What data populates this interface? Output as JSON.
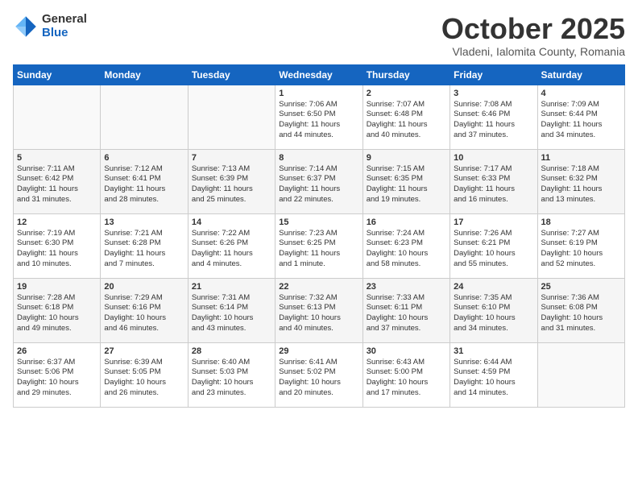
{
  "logo": {
    "general": "General",
    "blue": "Blue"
  },
  "title": "October 2025",
  "subtitle": "Vladeni, Ialomita County, Romania",
  "days_header": [
    "Sunday",
    "Monday",
    "Tuesday",
    "Wednesday",
    "Thursday",
    "Friday",
    "Saturday"
  ],
  "weeks": [
    [
      {
        "day": "",
        "content": ""
      },
      {
        "day": "",
        "content": ""
      },
      {
        "day": "",
        "content": ""
      },
      {
        "day": "1",
        "content": "Sunrise: 7:06 AM\nSunset: 6:50 PM\nDaylight: 11 hours\nand 44 minutes."
      },
      {
        "day": "2",
        "content": "Sunrise: 7:07 AM\nSunset: 6:48 PM\nDaylight: 11 hours\nand 40 minutes."
      },
      {
        "day": "3",
        "content": "Sunrise: 7:08 AM\nSunset: 6:46 PM\nDaylight: 11 hours\nand 37 minutes."
      },
      {
        "day": "4",
        "content": "Sunrise: 7:09 AM\nSunset: 6:44 PM\nDaylight: 11 hours\nand 34 minutes."
      }
    ],
    [
      {
        "day": "5",
        "content": "Sunrise: 7:11 AM\nSunset: 6:42 PM\nDaylight: 11 hours\nand 31 minutes."
      },
      {
        "day": "6",
        "content": "Sunrise: 7:12 AM\nSunset: 6:41 PM\nDaylight: 11 hours\nand 28 minutes."
      },
      {
        "day": "7",
        "content": "Sunrise: 7:13 AM\nSunset: 6:39 PM\nDaylight: 11 hours\nand 25 minutes."
      },
      {
        "day": "8",
        "content": "Sunrise: 7:14 AM\nSunset: 6:37 PM\nDaylight: 11 hours\nand 22 minutes."
      },
      {
        "day": "9",
        "content": "Sunrise: 7:15 AM\nSunset: 6:35 PM\nDaylight: 11 hours\nand 19 minutes."
      },
      {
        "day": "10",
        "content": "Sunrise: 7:17 AM\nSunset: 6:33 PM\nDaylight: 11 hours\nand 16 minutes."
      },
      {
        "day": "11",
        "content": "Sunrise: 7:18 AM\nSunset: 6:32 PM\nDaylight: 11 hours\nand 13 minutes."
      }
    ],
    [
      {
        "day": "12",
        "content": "Sunrise: 7:19 AM\nSunset: 6:30 PM\nDaylight: 11 hours\nand 10 minutes."
      },
      {
        "day": "13",
        "content": "Sunrise: 7:21 AM\nSunset: 6:28 PM\nDaylight: 11 hours\nand 7 minutes."
      },
      {
        "day": "14",
        "content": "Sunrise: 7:22 AM\nSunset: 6:26 PM\nDaylight: 11 hours\nand 4 minutes."
      },
      {
        "day": "15",
        "content": "Sunrise: 7:23 AM\nSunset: 6:25 PM\nDaylight: 11 hours\nand 1 minute."
      },
      {
        "day": "16",
        "content": "Sunrise: 7:24 AM\nSunset: 6:23 PM\nDaylight: 10 hours\nand 58 minutes."
      },
      {
        "day": "17",
        "content": "Sunrise: 7:26 AM\nSunset: 6:21 PM\nDaylight: 10 hours\nand 55 minutes."
      },
      {
        "day": "18",
        "content": "Sunrise: 7:27 AM\nSunset: 6:19 PM\nDaylight: 10 hours\nand 52 minutes."
      }
    ],
    [
      {
        "day": "19",
        "content": "Sunrise: 7:28 AM\nSunset: 6:18 PM\nDaylight: 10 hours\nand 49 minutes."
      },
      {
        "day": "20",
        "content": "Sunrise: 7:29 AM\nSunset: 6:16 PM\nDaylight: 10 hours\nand 46 minutes."
      },
      {
        "day": "21",
        "content": "Sunrise: 7:31 AM\nSunset: 6:14 PM\nDaylight: 10 hours\nand 43 minutes."
      },
      {
        "day": "22",
        "content": "Sunrise: 7:32 AM\nSunset: 6:13 PM\nDaylight: 10 hours\nand 40 minutes."
      },
      {
        "day": "23",
        "content": "Sunrise: 7:33 AM\nSunset: 6:11 PM\nDaylight: 10 hours\nand 37 minutes."
      },
      {
        "day": "24",
        "content": "Sunrise: 7:35 AM\nSunset: 6:10 PM\nDaylight: 10 hours\nand 34 minutes."
      },
      {
        "day": "25",
        "content": "Sunrise: 7:36 AM\nSunset: 6:08 PM\nDaylight: 10 hours\nand 31 minutes."
      }
    ],
    [
      {
        "day": "26",
        "content": "Sunrise: 6:37 AM\nSunset: 5:06 PM\nDaylight: 10 hours\nand 29 minutes."
      },
      {
        "day": "27",
        "content": "Sunrise: 6:39 AM\nSunset: 5:05 PM\nDaylight: 10 hours\nand 26 minutes."
      },
      {
        "day": "28",
        "content": "Sunrise: 6:40 AM\nSunset: 5:03 PM\nDaylight: 10 hours\nand 23 minutes."
      },
      {
        "day": "29",
        "content": "Sunrise: 6:41 AM\nSunset: 5:02 PM\nDaylight: 10 hours\nand 20 minutes."
      },
      {
        "day": "30",
        "content": "Sunrise: 6:43 AM\nSunset: 5:00 PM\nDaylight: 10 hours\nand 17 minutes."
      },
      {
        "day": "31",
        "content": "Sunrise: 6:44 AM\nSunset: 4:59 PM\nDaylight: 10 hours\nand 14 minutes."
      },
      {
        "day": "",
        "content": ""
      }
    ]
  ]
}
